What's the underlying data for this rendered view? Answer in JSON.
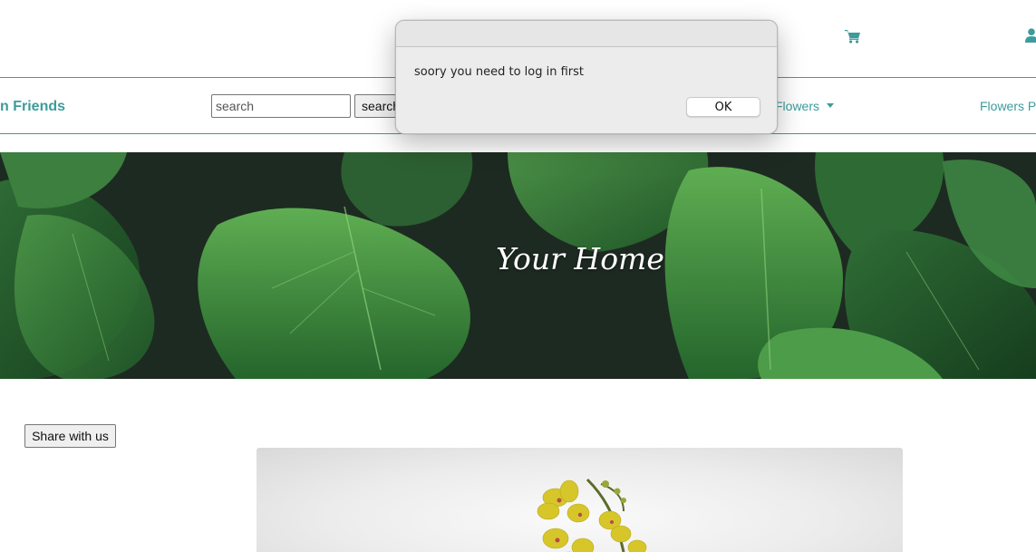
{
  "header": {
    "cart_icon": "shopping-cart-icon",
    "user_icon": "user-icon",
    "accent_color": "#3e9b9b"
  },
  "navbar": {
    "brand": "n Friends",
    "search": {
      "placeholder": "search",
      "button_label": "search"
    },
    "items": [
      {
        "label": "Flowers",
        "dropdown": true
      },
      {
        "label": "Flowers P"
      }
    ]
  },
  "hero": {
    "title": "Your Home"
  },
  "content": {
    "share_button": "Share with us"
  },
  "alert": {
    "message": "soory you need to log in first",
    "ok_label": "OK"
  }
}
